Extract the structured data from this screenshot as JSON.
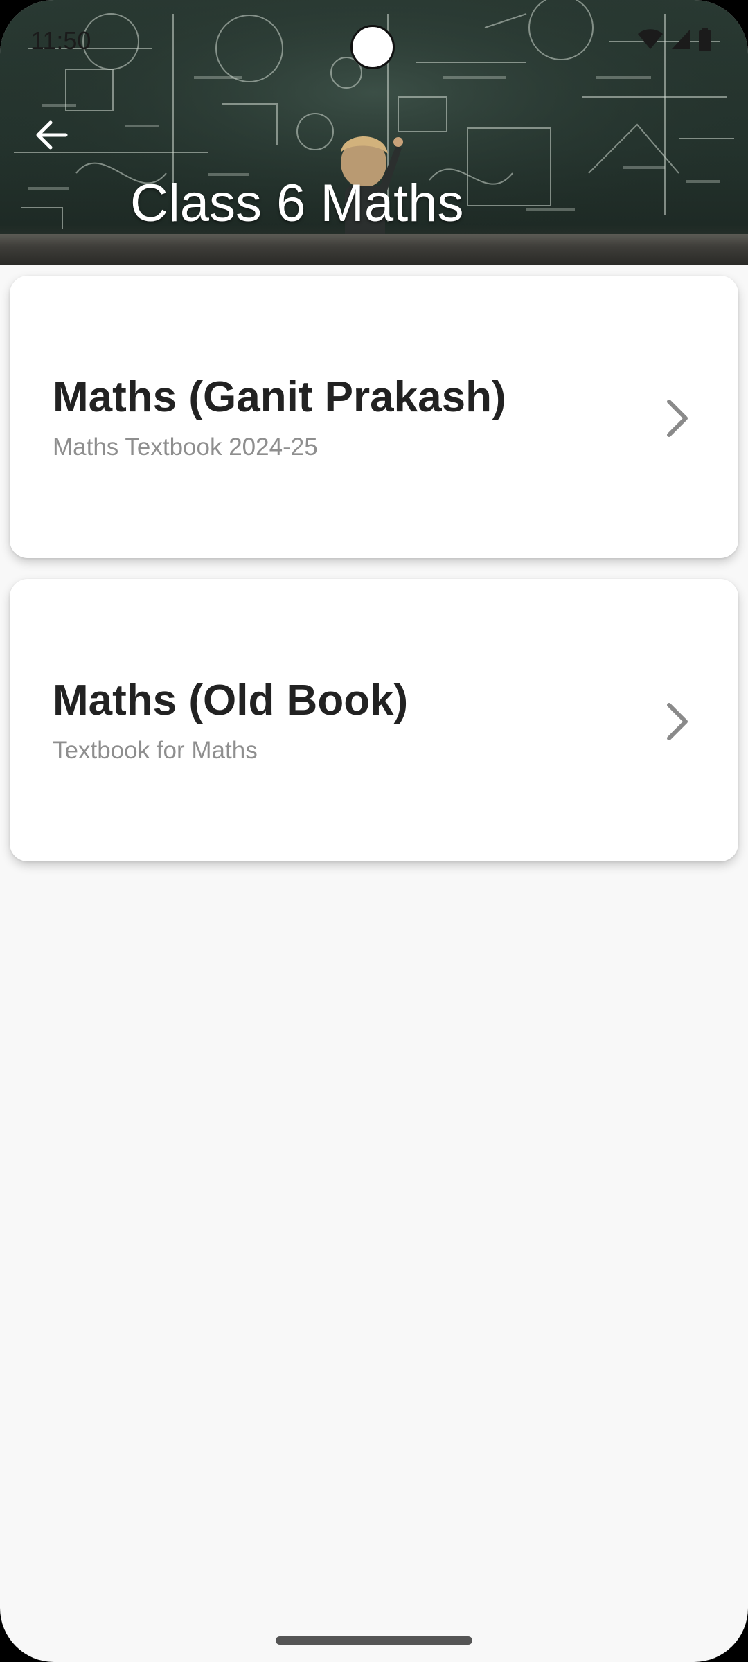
{
  "status_bar": {
    "time": "11:50",
    "icons": [
      "wifi-icon",
      "signal-icon",
      "battery-icon"
    ]
  },
  "header": {
    "title": "Class 6 Maths",
    "back_icon": "arrow-left-icon",
    "background": "chalkboard-image"
  },
  "books": [
    {
      "title": "Maths (Ganit Prakash)",
      "subtitle": "Maths Textbook 2024-25",
      "icon": "chevron-right-icon"
    },
    {
      "title": "Maths (Old Book)",
      "subtitle": "Textbook for Maths",
      "icon": "chevron-right-icon"
    }
  ],
  "colors": {
    "background": "#f8f8f8",
    "card": "#ffffff",
    "title_text": "#222222",
    "subtitle_text": "#8e8e8e",
    "header_title": "#ffffff"
  }
}
